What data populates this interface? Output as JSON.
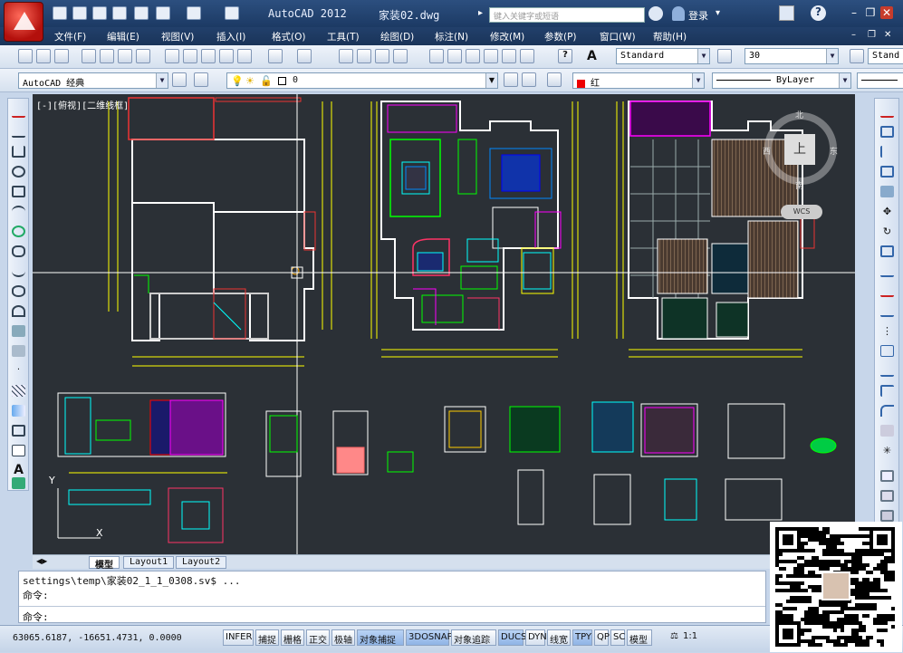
{
  "title": {
    "app": "AutoCAD 2012",
    "file": "家装02.dwg",
    "search_placeholder": "键入关键字或短语",
    "login": "登录"
  },
  "menu": [
    "文件(F)",
    "编辑(E)",
    "视图(V)",
    "插入(I)",
    "格式(O)",
    "工具(T)",
    "绘图(D)",
    "标注(N)",
    "修改(M)",
    "参数(P)",
    "窗口(W)",
    "帮助(H)"
  ],
  "toolbar": {
    "text_style": "Standard",
    "dim_style": "30",
    "dim_style2": "Stand",
    "workspace": "AutoCAD 经典",
    "layer": "0",
    "color": "红",
    "linetype": "ByLayer"
  },
  "viewport": {
    "label": "[-][俯视][二维线框]"
  },
  "viewcube": {
    "face": "上",
    "north": "北",
    "south": "南",
    "west": "西",
    "east": "东",
    "wcs": "WCS"
  },
  "tabs": [
    "模型",
    "Layout1",
    "Layout2"
  ],
  "command": {
    "line1": "settings\\temp\\家装02_1_1_0308.sv$ ...",
    "line2": "命令:",
    "prompt": "命令:"
  },
  "status": {
    "coords": "63065.6187, -16651.4731, 0.0000",
    "toggles": [
      {
        "label": "INFER",
        "on": false
      },
      {
        "label": "捕捉",
        "on": false
      },
      {
        "label": "栅格",
        "on": false
      },
      {
        "label": "正交",
        "on": false
      },
      {
        "label": "极轴",
        "on": false
      },
      {
        "label": "对象捕捉",
        "on": true
      },
      {
        "label": "3DOSNAP",
        "on": true
      },
      {
        "label": "对象追踪",
        "on": false
      },
      {
        "label": "DUCS",
        "on": true
      },
      {
        "label": "DYN",
        "on": false
      },
      {
        "label": "线宽",
        "on": false
      },
      {
        "label": "TPY",
        "on": true
      },
      {
        "label": "QP",
        "on": false
      },
      {
        "label": "SC",
        "on": false
      },
      {
        "label": "模型",
        "on": false
      }
    ],
    "scale": "1:1"
  },
  "colors": {
    "canvas": "#2b3036",
    "walls": "#ffffff",
    "dims": "#ffff00",
    "accent_red": "#ff0000",
    "cyan": "#00ffff",
    "magenta": "#ff00ff",
    "green": "#00ff00"
  }
}
